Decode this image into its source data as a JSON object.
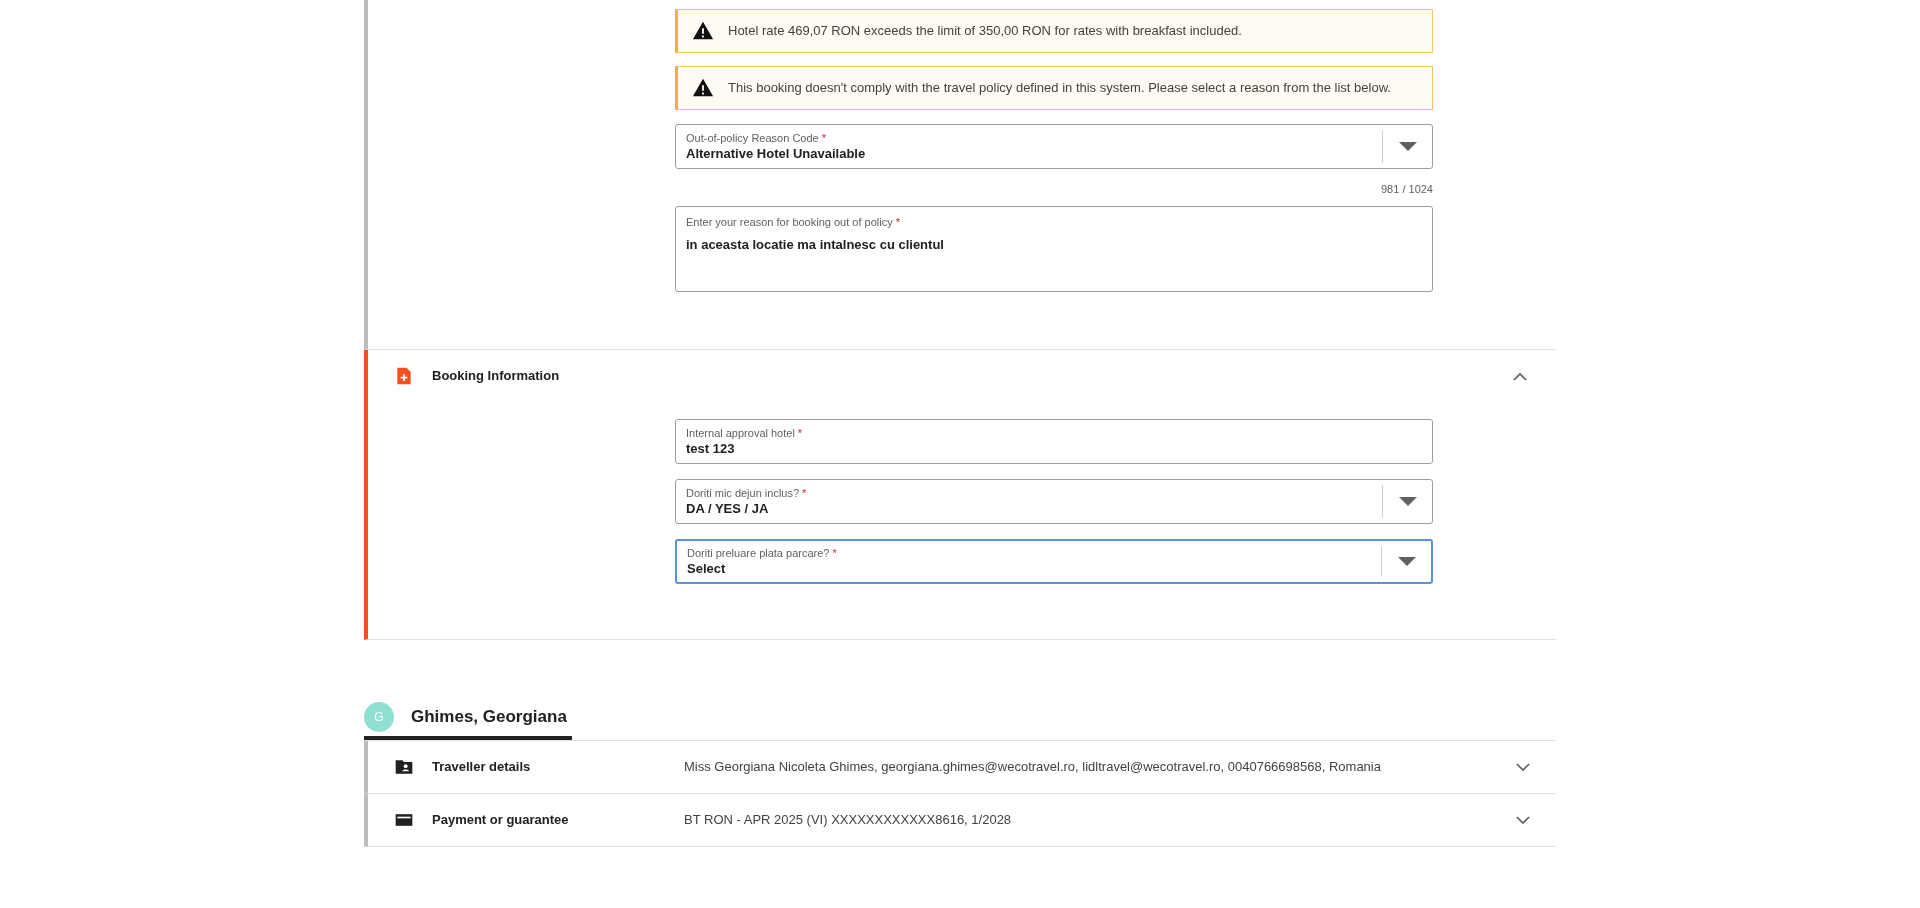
{
  "policy_section": {
    "alerts": [
      "Hotel rate 469,07 RON exceeds the limit of 350,00 RON for rates with breakfast included.",
      "This booking doesn't comply with the travel policy defined in this system. Please select a reason from the list below."
    ],
    "reason_code": {
      "label": "Out-of-policy Reason Code",
      "required_mark": "*",
      "value": "Alternative Hotel Unavailable"
    },
    "counter": "981 / 1024",
    "reason_text": {
      "label": "Enter your reason for booking out of policy",
      "required_mark": "*",
      "value": "in aceasta locatie ma intalnesc cu clientul"
    }
  },
  "booking_section": {
    "title": "Booking Information",
    "expanded": true,
    "fields": [
      {
        "kind": "text",
        "label": "Internal approval hotel",
        "required_mark": "*",
        "value": "test 123",
        "focused": false
      },
      {
        "kind": "select",
        "label": "Doriti mic dejun inclus?",
        "required_mark": "*",
        "value": "DA / YES / JA",
        "focused": false
      },
      {
        "kind": "select",
        "label": "Doriti preluare plata parcare?",
        "required_mark": "*",
        "value": "Select",
        "focused": true
      }
    ]
  },
  "traveller": {
    "initial": "G",
    "name": "Ghimes, Georgiana",
    "rows": [
      {
        "kind": "person",
        "title": "Traveller details",
        "summary": "Miss Georgiana Nicoleta Ghimes, georgiana.ghimes@wecotravel.ro, lidltravel@wecotravel.ro, 0040766698568, Romania",
        "expanded": false
      },
      {
        "kind": "card",
        "title": "Payment or guarantee",
        "summary": "BT RON - APR 2025 (VI) XXXXXXXXXXXX8616, 1/2028",
        "expanded": false
      }
    ]
  }
}
